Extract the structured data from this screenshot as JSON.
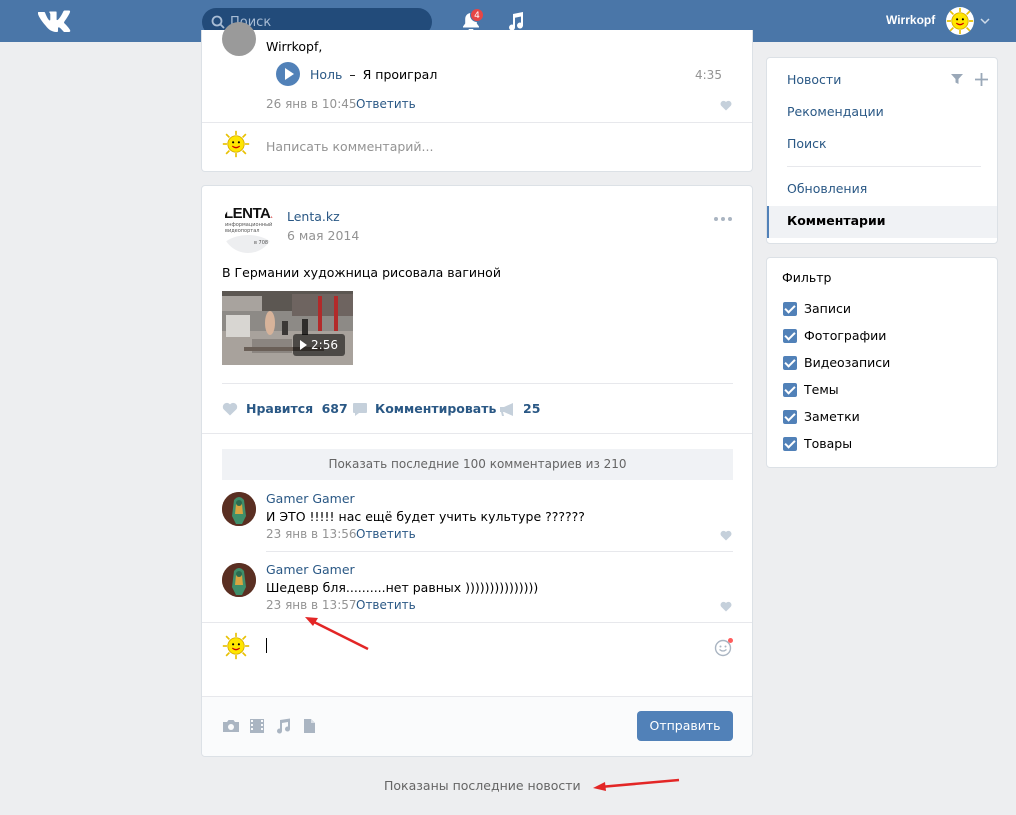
{
  "header": {
    "search_placeholder": "Поиск",
    "notifications_count": "4",
    "username": "Wirrkopf"
  },
  "post1": {
    "comment_author": "Wirrkopf,",
    "audio": {
      "artist": "Ноль",
      "separator": "–",
      "title": "Я проиграл",
      "duration": "4:35"
    },
    "comment_date": "26 янв в 10:45",
    "reply_label": "Ответить",
    "write_comment_placeholder": "Написать комментарий..."
  },
  "post2": {
    "author": "Lenta.kz",
    "date": "6 мая 2014",
    "logo": {
      "title_prefix": "LENTA",
      "title_suffix": ".",
      "subtitle": "информационный видеопортал",
      "tag": "в 708"
    },
    "text": "В Германии художница рисовала вагиной",
    "video_duration": "2:56",
    "actions": {
      "like_label": "Нравится",
      "like_count": "687",
      "comment_label": "Комментировать",
      "share_count": "25"
    },
    "show_more_comments": "Показать последние 100 комментариев из 210",
    "comments": [
      {
        "author": "Gamer Gamer",
        "text": "И ЭТО !!!!! нас ещё будет учить культуре ??????",
        "date": "23 янв в 13:56",
        "reply": "Ответить"
      },
      {
        "author": "Gamer Gamer",
        "text": "Шедевр бля..........нет равных )))))))))))))))",
        "date": "23 янв в 13:57",
        "reply": "Ответить"
      }
    ],
    "send_label": "Отправить"
  },
  "right_menu": {
    "items": [
      "Новости",
      "Рекомендации",
      "Поиск"
    ],
    "items2": [
      "Обновления",
      "Комментарии"
    ],
    "active": "Комментарии"
  },
  "filter": {
    "title": "Фильтр",
    "options": [
      "Записи",
      "Фотографии",
      "Видеозаписи",
      "Темы",
      "Заметки",
      "Товары"
    ]
  },
  "footer": {
    "text": "Показаны последние новости"
  },
  "colors": {
    "header": "#4a76a8",
    "accent": "#5181b8",
    "link": "#2a5885",
    "background": "#edeef0",
    "annotation_arrow": "#e32626"
  }
}
